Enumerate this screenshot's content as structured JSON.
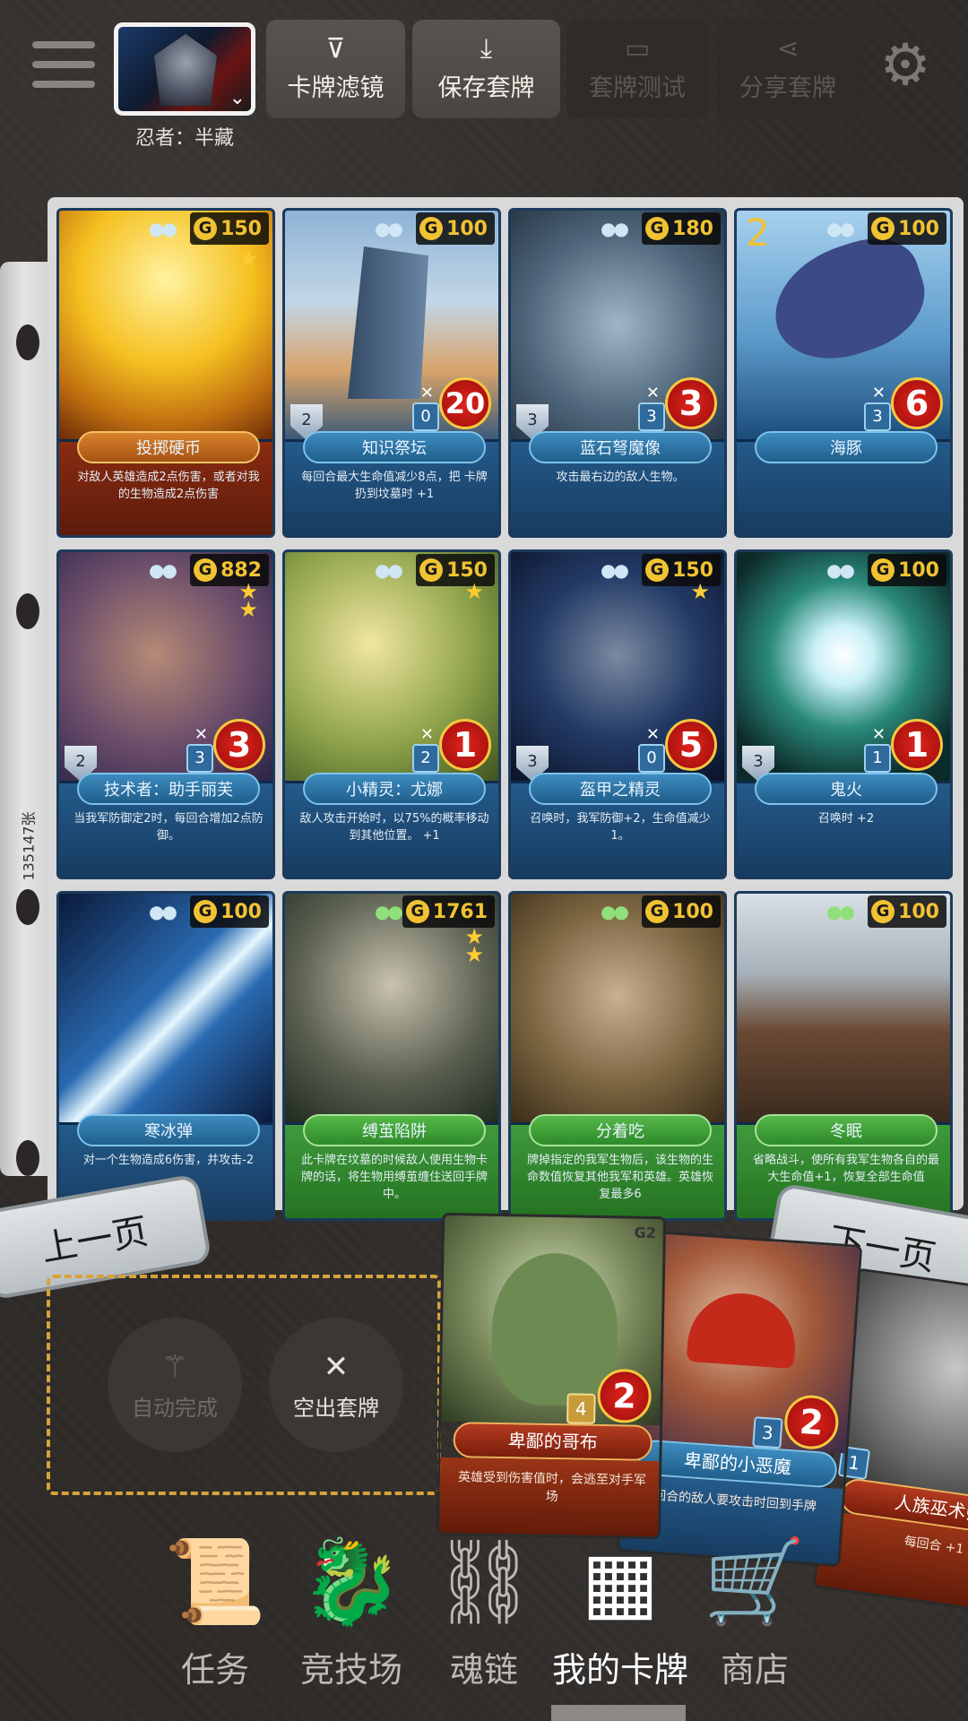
{
  "header": {
    "hero_name": "忍者：半藏",
    "buttons": [
      {
        "label": "卡牌滤镜",
        "icon": "filter-icon",
        "enabled": true
      },
      {
        "label": "保存套牌",
        "icon": "download-icon",
        "enabled": true
      },
      {
        "label": "套牌测试",
        "icon": "cards-icon",
        "enabled": false
      },
      {
        "label": "分享套牌",
        "icon": "share-icon",
        "enabled": false
      }
    ]
  },
  "collection": {
    "count_label": "135147张",
    "cards": [
      {
        "name": "投掷硬币",
        "cost": "150",
        "desc": "对敌人英雄造成2点伤害，或者对我的生物造成2点伤害",
        "style": "red",
        "stars": 1
      },
      {
        "name": "知识祭坛",
        "cost": "100",
        "desc": "每回合最大生命值减少8点，把 卡牌扔到坟墓时 +1",
        "style": "blue",
        "shield": "2",
        "hp": "0",
        "atk": "20"
      },
      {
        "name": "蓝石弩魔像",
        "cost": "180",
        "desc": "攻击最右边的敌人生物。",
        "style": "blue",
        "shield": "3",
        "hp": "3",
        "atk": "3"
      },
      {
        "name": "海豚",
        "cost": "100",
        "desc": "",
        "style": "blue",
        "hp": "3",
        "atk": "6",
        "big_num": "2"
      },
      {
        "name": "技术者：助手丽芙",
        "cost": "882",
        "desc": "当我军防御定2时，每回合增加2点防御。",
        "style": "blue",
        "shield": "2",
        "hp": "3",
        "atk": "3",
        "stars": 2
      },
      {
        "name": "小精灵：尤娜",
        "cost": "150",
        "desc": "敌人攻击开始时，以75%的概率移动到其他位置。 +1",
        "style": "blue",
        "hp": "2",
        "atk": "1",
        "stars": 1
      },
      {
        "name": "盔甲之精灵",
        "cost": "150",
        "desc": "召唤时，我军防御+2，生命值减少1。",
        "style": "blue",
        "shield": "3",
        "hp": "0",
        "atk": "5",
        "stars": 1
      },
      {
        "name": "鬼火",
        "cost": "100",
        "desc": "召唤时 +2",
        "style": "blue",
        "shield": "3",
        "hp": "1",
        "atk": "1"
      },
      {
        "name": "寒冰弹",
        "cost": "100",
        "desc": "对一个生物造成6伤害，并攻击-2",
        "style": "blue"
      },
      {
        "name": "缚茧陷阱",
        "cost": "1761",
        "desc": "此卡牌在坟墓的时候敌人使用生物卡牌的话，将生物用缚茧缠住送回手牌中。",
        "style": "green",
        "stars": 2
      },
      {
        "name": "分着吃",
        "cost": "100",
        "desc": "牌掉指定的我军生物后，该生物的生命数值恢复其他我军和英雄。英雄恢复最多6",
        "style": "green"
      },
      {
        "name": "冬眠",
        "cost": "100",
        "desc": "省略战斗，使所有我军生物各自的最大生命值+1，恢复全部生命值",
        "style": "green"
      }
    ]
  },
  "pager": {
    "prev": "上一页",
    "next": "下一页"
  },
  "deck_actions": {
    "auto_complete": "自动完成",
    "clear_deck": "空出套牌"
  },
  "hand": [
    {
      "name": "卑鄙的哥布",
      "hp": "4",
      "atk": "2",
      "desc": "英雄受到伤害值时，会逃至对手军场",
      "tag": "G2"
    },
    {
      "name": "卑鄙的小恶魔",
      "hp": "3",
      "atk": "2",
      "desc": "回合的敌人要攻击时回到手牌"
    },
    {
      "name": "人族巫术师",
      "hp": "1",
      "atk": "",
      "desc": "每回合 +1"
    }
  ],
  "nav": [
    {
      "label": "任务",
      "icon": "scroll-icon",
      "active": false
    },
    {
      "label": "竞技场",
      "icon": "dragon-icon",
      "active": false
    },
    {
      "label": "魂链",
      "icon": "chain-icon",
      "active": false
    },
    {
      "label": "我的卡牌",
      "icon": "card-grid-icon",
      "active": true
    },
    {
      "label": "商店",
      "icon": "cart-icon",
      "active": false
    }
  ]
}
